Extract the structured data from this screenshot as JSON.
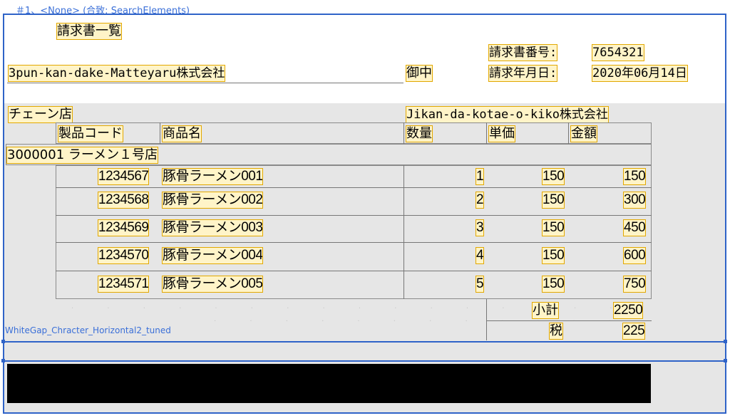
{
  "caption": "＃1、<None> (合致: SearchElements)",
  "header": {
    "title": "請求書一覧",
    "customer": "3pun-kan-dake-Matteyaru株式会社",
    "honorific": "御中",
    "invoice_no_label": "請求書番号:",
    "invoice_no": "7654321",
    "invoice_date_label": "請求年月日:",
    "invoice_date": "2020年06月14日"
  },
  "store": {
    "label": "チェーン店",
    "company": "Jikan-da-kotae-o-kiko株式会社"
  },
  "columns": {
    "code": "製品コード",
    "name": "商品名",
    "qty": "数量",
    "price": "単価",
    "amount": "金額"
  },
  "group": "3000001 ラーメン１号店",
  "rows": [
    {
      "code": "1234567",
      "name": "豚骨ラーメン001",
      "qty": "1",
      "price": "150",
      "amount": "150"
    },
    {
      "code": "1234568",
      "name": "豚骨ラーメン002",
      "qty": "2",
      "price": "150",
      "amount": "300"
    },
    {
      "code": "1234569",
      "name": "豚骨ラーメン003",
      "qty": "3",
      "price": "150",
      "amount": "450"
    },
    {
      "code": "1234570",
      "name": "豚骨ラーメン004",
      "qty": "4",
      "price": "150",
      "amount": "600"
    },
    {
      "code": "1234571",
      "name": "豚骨ラーメン005",
      "qty": "5",
      "price": "150",
      "amount": "750"
    }
  ],
  "totals": {
    "subtotal_label": "小計",
    "subtotal": "2250",
    "tax_label": "税",
    "tax": "225"
  },
  "annotation": "WhiteGap_Chracter_Horizontal2_tuned",
  "colors": {
    "highlight_fill": "#fff4c8",
    "highlight_border": "#e2a800",
    "selection_blue": "#2f63c8",
    "report_gray": "#e6e6e6"
  }
}
